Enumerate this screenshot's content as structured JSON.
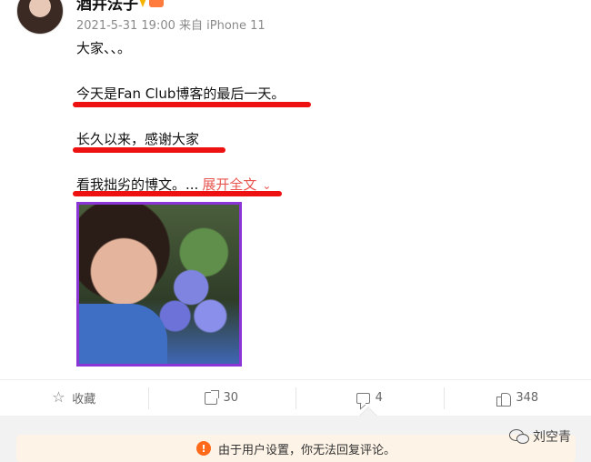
{
  "post": {
    "author": "酒井法子",
    "meta": "2021-5-31 19:00 来自 iPhone 11",
    "lines": [
      "大家、、。",
      "今天是Fan Club博客的最后一天。",
      "长久以来，感谢大家",
      "看我拙劣的博文。..."
    ],
    "expand_label": "展开全文",
    "expand_chevron": "⌄"
  },
  "actions": {
    "favorite": "收藏",
    "repost_count": "30",
    "comment_count": "4",
    "like_count": "348"
  },
  "notice": {
    "icon": "!",
    "text": "由于用户设置，你无法回复评论。"
  },
  "watermark": {
    "text": "刘空青"
  },
  "colors": {
    "underline": "#ee1111",
    "photo_border": "#8b35d6",
    "expand": "#e8554e",
    "warning": "#ff6a1a"
  },
  "icons": [
    "star-icon",
    "share-icon",
    "comment-icon",
    "like-icon",
    "warning-icon",
    "wechat-icon"
  ]
}
